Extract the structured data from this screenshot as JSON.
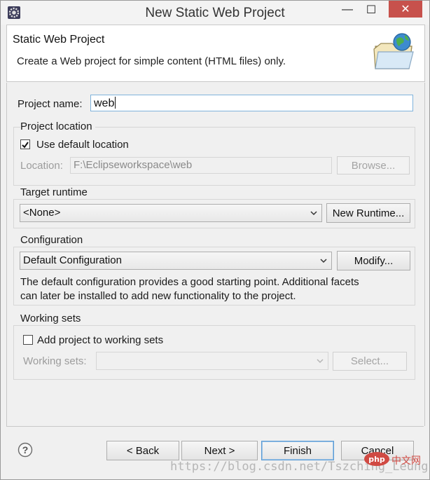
{
  "window": {
    "title": "New Static Web Project",
    "minimize_glyph": "—",
    "maximize_glyph": "☐",
    "close_glyph": "✕"
  },
  "banner": {
    "title": "Static Web Project",
    "description": "Create a Web project for simple content (HTML files) only.",
    "icon": "folder-globe-icon"
  },
  "project_name": {
    "label": "Project name:",
    "value": "web"
  },
  "project_location": {
    "title": "Project location",
    "use_default_label": "Use default location",
    "use_default_checked": true,
    "location_label": "Location:",
    "location_value": "F:\\Eclipseworkspace\\web",
    "browse_label": "Browse..."
  },
  "target_runtime": {
    "title": "Target runtime",
    "selected": "<None>",
    "new_runtime_label": "New Runtime..."
  },
  "configuration": {
    "title": "Configuration",
    "selected": "Default Configuration",
    "modify_label": "Modify...",
    "description_line1": "The default configuration provides a good starting point. Additional facets",
    "description_line2": "can later be installed to add new functionality to the project."
  },
  "working_sets": {
    "title": "Working sets",
    "add_label": "Add project to working sets",
    "add_checked": false,
    "sets_label": "Working sets:",
    "sets_value": "",
    "select_label": "Select..."
  },
  "footer": {
    "help_glyph": "?",
    "back_label": "< Back",
    "next_label": "Next >",
    "finish_label": "Finish",
    "cancel_label": "Cancel"
  },
  "watermark": {
    "text": "https://blog.csdn.net/Tszching_Leung",
    "badge": "php",
    "badge_suffix": "中文网"
  },
  "colors": {
    "accent_border": "#5a9bd5",
    "close_button": "#c7514c",
    "input_focus": "#7fb3dc"
  }
}
